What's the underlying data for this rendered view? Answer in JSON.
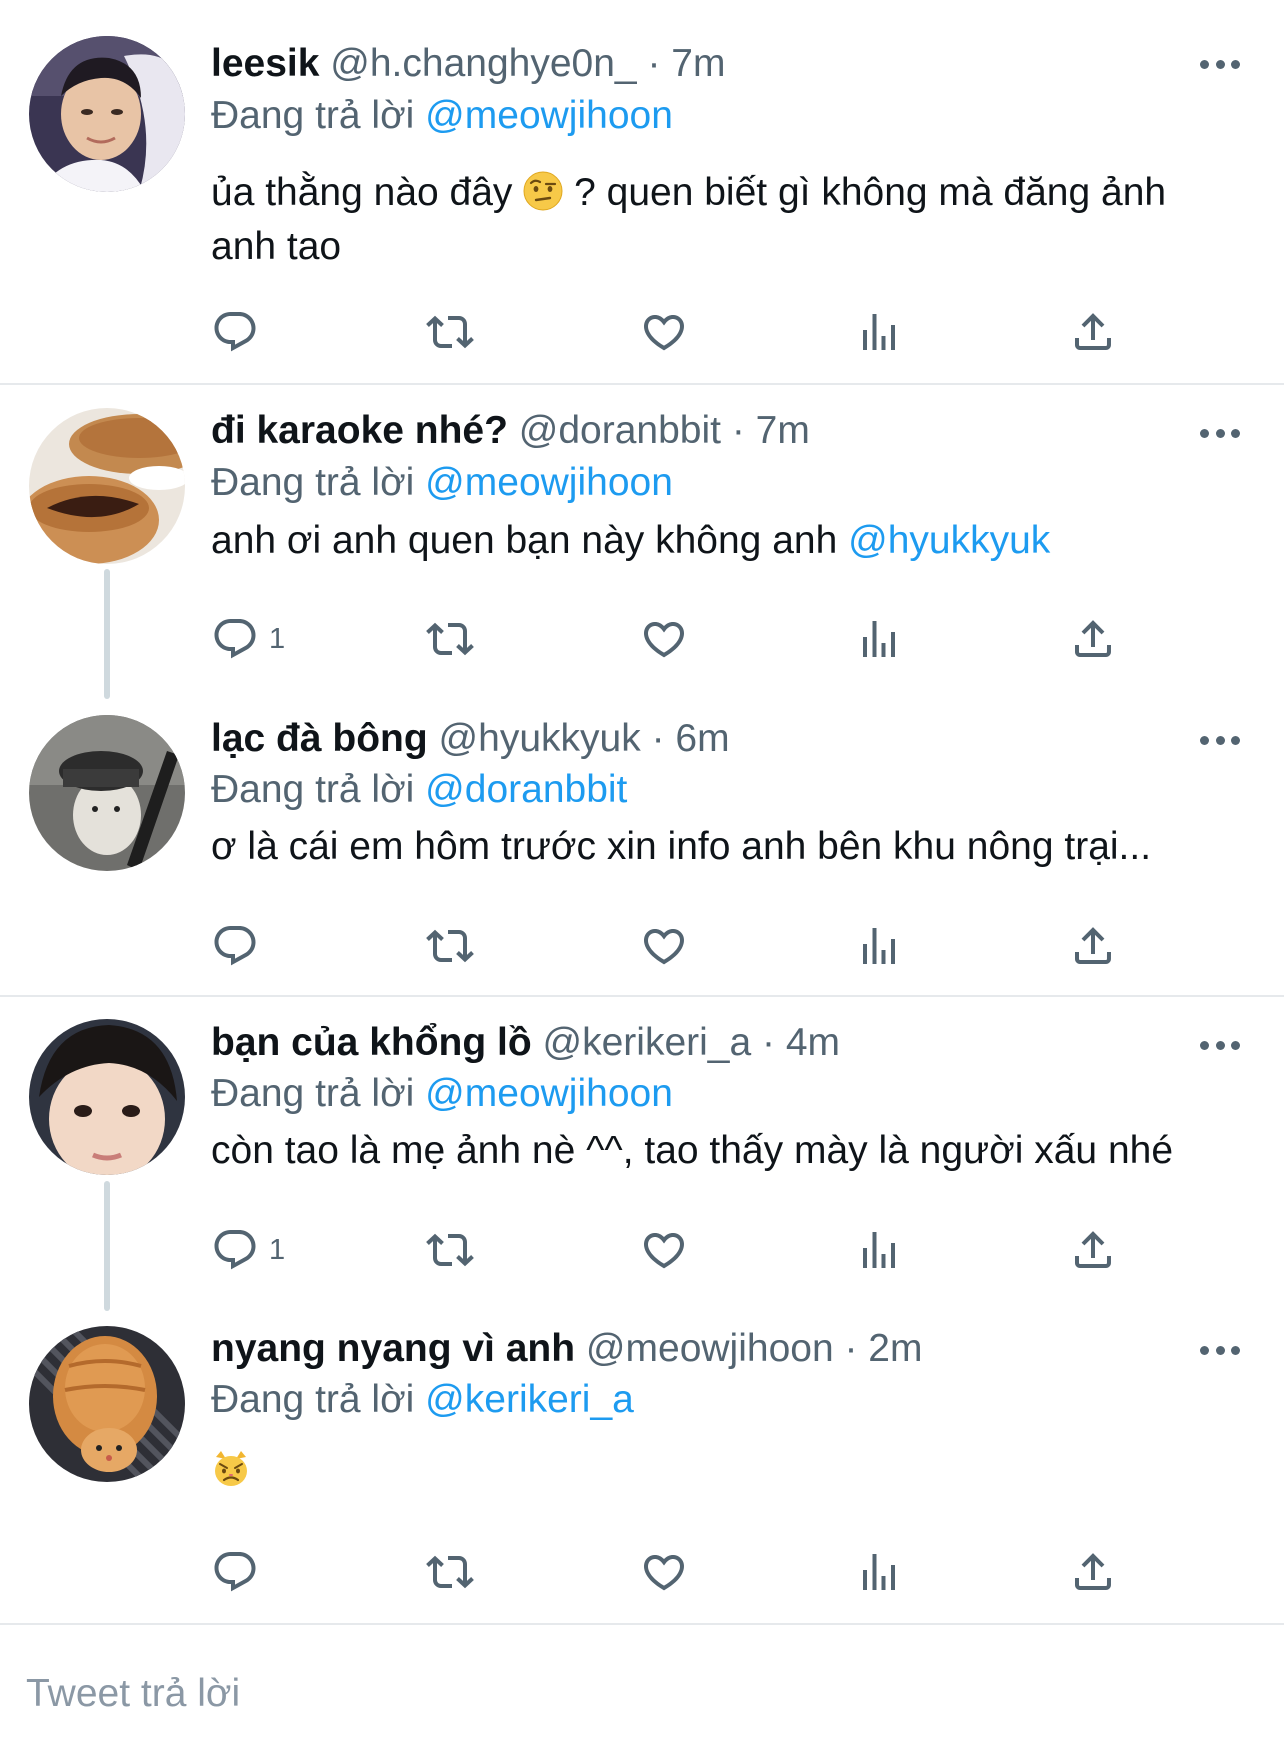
{
  "tweets": [
    {
      "name": "leesik",
      "handle": "@h.changhye0n_",
      "time": "· 7m",
      "replying_prefix": "Đang trả lời",
      "replying_to": "@meowjihoon",
      "text_before": "ủa thằng nào đây",
      "text_after": "? quen biết gì không mà đăng ảnh anh tao",
      "reply_count": ""
    },
    {
      "name": "đi karaoke nhé?",
      "handle": "@doranbbit",
      "time": "· 7m",
      "replying_prefix": "Đang trả lời",
      "replying_to": "@meowjihoon",
      "text_before": "anh ơi anh quen bạn này không anh",
      "text_mention": "@hyukkyuk",
      "reply_count": "1"
    },
    {
      "name": "lạc đà bông",
      "handle": "@hyukkyuk",
      "time": "· 6m",
      "replying_prefix": "Đang trả lời",
      "replying_to": "@doranbbit",
      "text": "ơ là cái em hôm trước xin info anh bên khu nông trại...",
      "reply_count": ""
    },
    {
      "name": "bạn của khổng lồ",
      "handle": "@kerikeri_a",
      "time": "· 4m",
      "replying_prefix": "Đang trả lời",
      "replying_to": "@meowjihoon",
      "text": "còn tao là mẹ ảnh nè ^^, tao thấy mày là người xấu nhé",
      "reply_count": "1"
    },
    {
      "name": "nyang nyang vì anh",
      "handle": "@meowjihoon",
      "time": "· 2m",
      "replying_prefix": "Đang trả lời",
      "replying_to": "@kerikeri_a",
      "reply_count": ""
    }
  ],
  "compose": {
    "placeholder": "Tweet trả lời"
  },
  "icons": {
    "reply": "reply-icon",
    "retweet": "retweet-icon",
    "like": "heart-icon",
    "views": "analytics-icon",
    "share": "share-icon",
    "more": "more-icon",
    "raised_eyebrow": "face-with-raised-eyebrow-emoji",
    "pouting_cat": "pouting-cat-emoji"
  },
  "colors": {
    "accent": "#1d9bf0",
    "secondary_text": "#536471",
    "primary_text": "#0f1419",
    "divider": "#e6e9ec",
    "thread_line": "#cfd9de"
  }
}
